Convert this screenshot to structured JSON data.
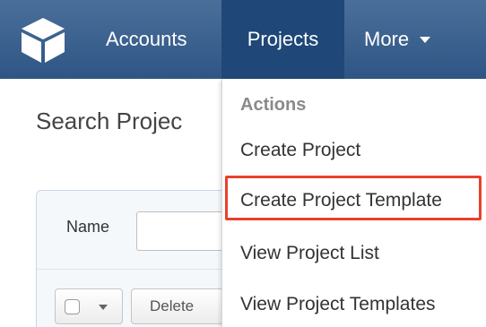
{
  "nav": {
    "logo_icon": "cube-logo-icon",
    "items": [
      {
        "label": "Accounts"
      },
      {
        "label": "Projects"
      },
      {
        "label": "More"
      }
    ],
    "more_caret_icon": "caret-down-icon",
    "colors": {
      "bar": "#2f5585",
      "active": "#1f4777"
    }
  },
  "page": {
    "title": "Search Projec"
  },
  "filter": {
    "name_label": "Name",
    "name_value": ""
  },
  "list_toolbar": {
    "delete_label": "Delete"
  },
  "dropdown": {
    "header": "Actions",
    "items": [
      {
        "label": "Create Project"
      },
      {
        "label": "Create Project Template"
      },
      {
        "label": "View Project List"
      },
      {
        "label": "View Project Templates"
      }
    ],
    "highlight_color": "#e8412c"
  }
}
